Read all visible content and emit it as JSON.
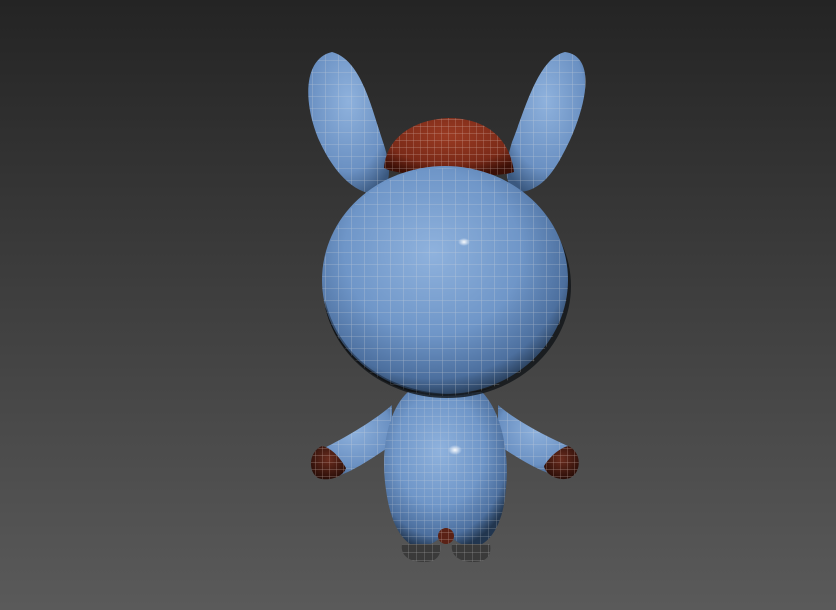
{
  "viewport": {
    "background_top": "#242424",
    "background_bottom": "#5a5a5a"
  },
  "model": {
    "subject": "bunny-character-back-view",
    "body_color": "#6f96c8",
    "body_shadow": "#2f4c72",
    "body_highlight": "#a9c6ea",
    "hat_color": "#7a2a18",
    "hat_shadow": "#3a0f06",
    "hand_color": "#5a2216",
    "foot_color": "#3a3a3a",
    "wire_color": "#d8d8d8"
  }
}
